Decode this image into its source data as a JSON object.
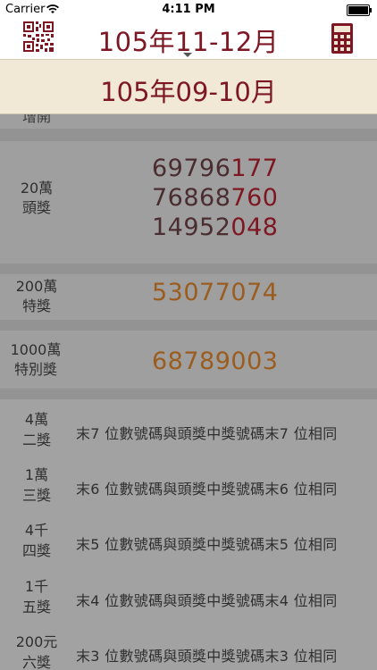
{
  "status": {
    "carrier": "Carrier",
    "time": "4:11 PM"
  },
  "nav": {
    "title": "105年11-12月"
  },
  "dropdown": {
    "option": "105年09-10月"
  },
  "prizes": {
    "top_partial": "增開",
    "first": {
      "label_amount": "20萬",
      "label_name": "頭獎",
      "numbers": [
        {
          "prefix": "69796",
          "suffix": "177"
        },
        {
          "prefix": "76868",
          "suffix": "760"
        },
        {
          "prefix": "14952",
          "suffix": "048"
        }
      ]
    },
    "special": {
      "label_amount": "200萬",
      "label_name": "特獎",
      "number": "53077074"
    },
    "grand": {
      "label_amount": "1000萬",
      "label_name": "特別獎",
      "number": "68789003"
    },
    "rules": [
      {
        "amount": "4萬",
        "name": "二獎",
        "desc": "末7 位數號碼與頭獎中獎號碼末7 位相同"
      },
      {
        "amount": "1萬",
        "name": "三獎",
        "desc": "末6 位數號碼與頭獎中獎號碼末6 位相同"
      },
      {
        "amount": "4千",
        "name": "四獎",
        "desc": "末5 位數號碼與頭獎中獎號碼末5 位相同"
      },
      {
        "amount": "1千",
        "name": "五獎",
        "desc": "末4 位數號碼與頭獎中獎號碼末4 位相同"
      },
      {
        "amount": "200元",
        "name": "六獎",
        "desc": "末3 位數號碼與頭獎中獎號碼末3 位相同"
      }
    ]
  },
  "colors": {
    "accent": "#7d1723",
    "gold": "#9b5d1f",
    "dropdown_bg": "#f1e8d6"
  },
  "icons": {
    "left": "qr-code-icon",
    "right": "calculator-icon"
  }
}
